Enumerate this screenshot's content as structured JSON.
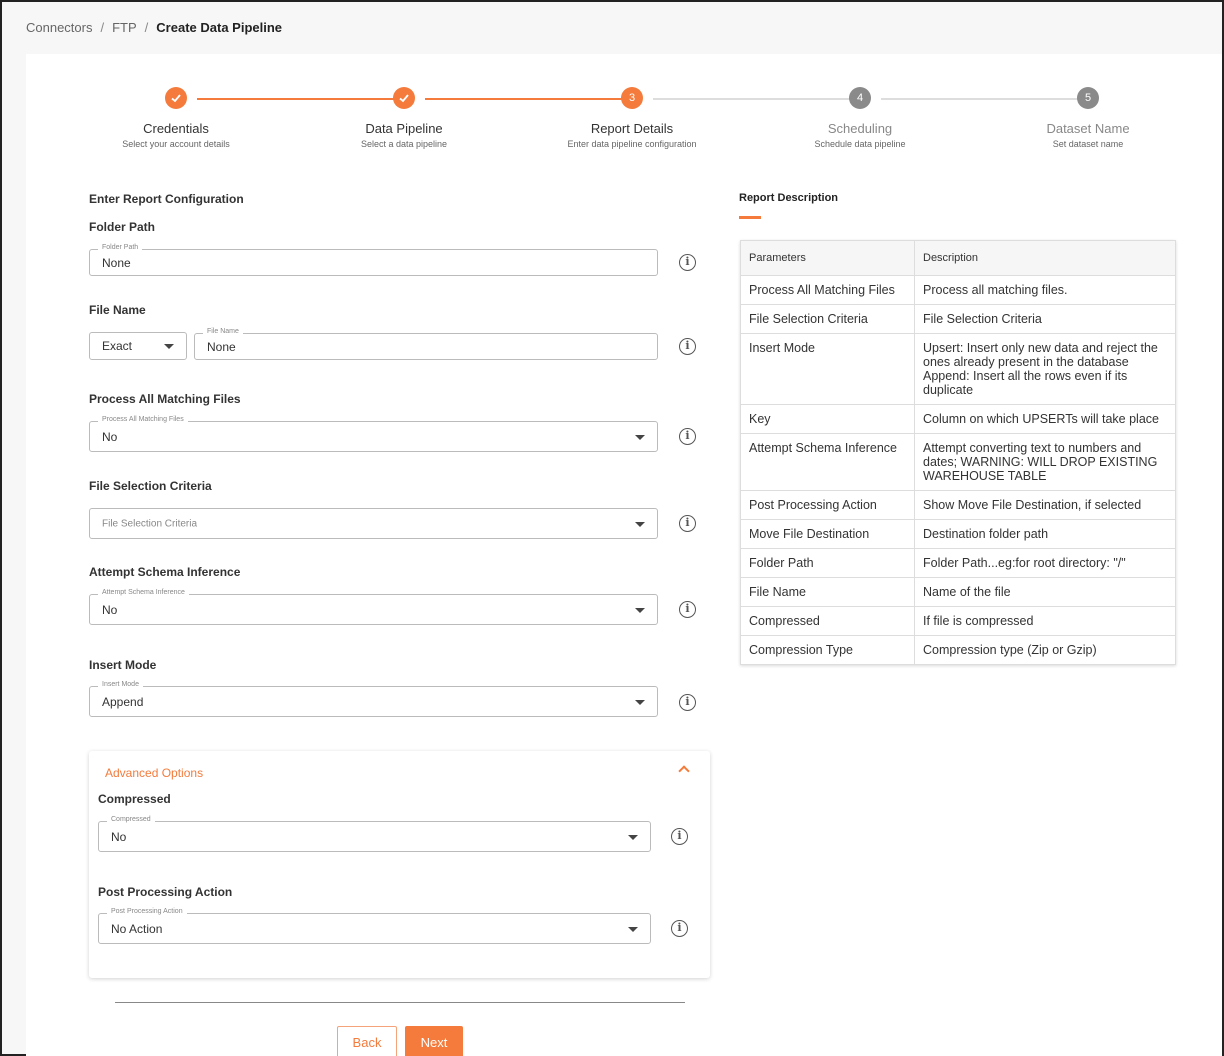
{
  "breadcrumb": {
    "items": [
      "Connectors",
      "FTP"
    ],
    "current": "Create Data Pipeline"
  },
  "stepper": {
    "steps": [
      {
        "number": "1",
        "title": "Credentials",
        "subtitle": "Select your account details",
        "state": "done"
      },
      {
        "number": "2",
        "title": "Data Pipeline",
        "subtitle": "Select a data pipeline",
        "state": "done"
      },
      {
        "number": "3",
        "title": "Report Details",
        "subtitle": "Enter data pipeline configuration",
        "state": "active"
      },
      {
        "number": "4",
        "title": "Scheduling",
        "subtitle": "Schedule data pipeline",
        "state": "pending"
      },
      {
        "number": "5",
        "title": "Dataset Name",
        "subtitle": "Set dataset name",
        "state": "pending"
      }
    ]
  },
  "form": {
    "heading": "Enter Report Configuration",
    "folder_path": {
      "label": "Folder Path",
      "legend": "Folder Path",
      "value": "None"
    },
    "file_name": {
      "label": "File Name",
      "match": "Exact",
      "legend": "File Name",
      "value": "None"
    },
    "process_all": {
      "label": "Process All Matching Files",
      "legend": "Process All Matching Files",
      "value": "No"
    },
    "selection_criteria": {
      "label": "File Selection Criteria",
      "placeholder": "File Selection Criteria"
    },
    "schema_inference": {
      "label": "Attempt Schema Inference",
      "legend": "Attempt Schema Inference",
      "value": "No"
    },
    "insert_mode": {
      "label": "Insert Mode",
      "legend": "Insert Mode",
      "value": "Append"
    },
    "advanced": {
      "title": "Advanced Options",
      "compressed": {
        "label": "Compressed",
        "legend": "Compressed",
        "value": "No"
      },
      "post_processing": {
        "label": "Post Processing Action",
        "legend": "Post Processing Action",
        "value": "No Action"
      }
    },
    "back_label": "Back",
    "next_label": "Next"
  },
  "report_description": {
    "title": "Report Description",
    "headers": [
      "Parameters",
      "Description"
    ],
    "rows": [
      [
        "Process All Matching Files",
        "Process all matching files."
      ],
      [
        "File Selection Criteria",
        "File Selection Criteria"
      ],
      [
        "Insert Mode",
        "Upsert: Insert only new data and reject the ones already present in the database Append: Insert all the rows even if its duplicate"
      ],
      [
        "Key",
        "Column on which UPSERTs will take place"
      ],
      [
        "Attempt Schema Inference",
        "Attempt converting text to numbers and dates; WARNING: WILL DROP EXISTING WAREHOUSE TABLE"
      ],
      [
        "Post Processing Action",
        "Show Move File Destination, if selected"
      ],
      [
        "Move File Destination",
        "Destination folder path"
      ],
      [
        "Folder Path",
        "Folder Path...eg:for root directory: \"/\""
      ],
      [
        "File Name",
        "Name of the file"
      ],
      [
        "Compressed",
        "If file is compressed"
      ],
      [
        "Compression Type",
        "Compression type (Zip or Gzip)"
      ]
    ]
  },
  "colors": {
    "accent": "#f47b3c",
    "pending": "#8a8a8a"
  }
}
